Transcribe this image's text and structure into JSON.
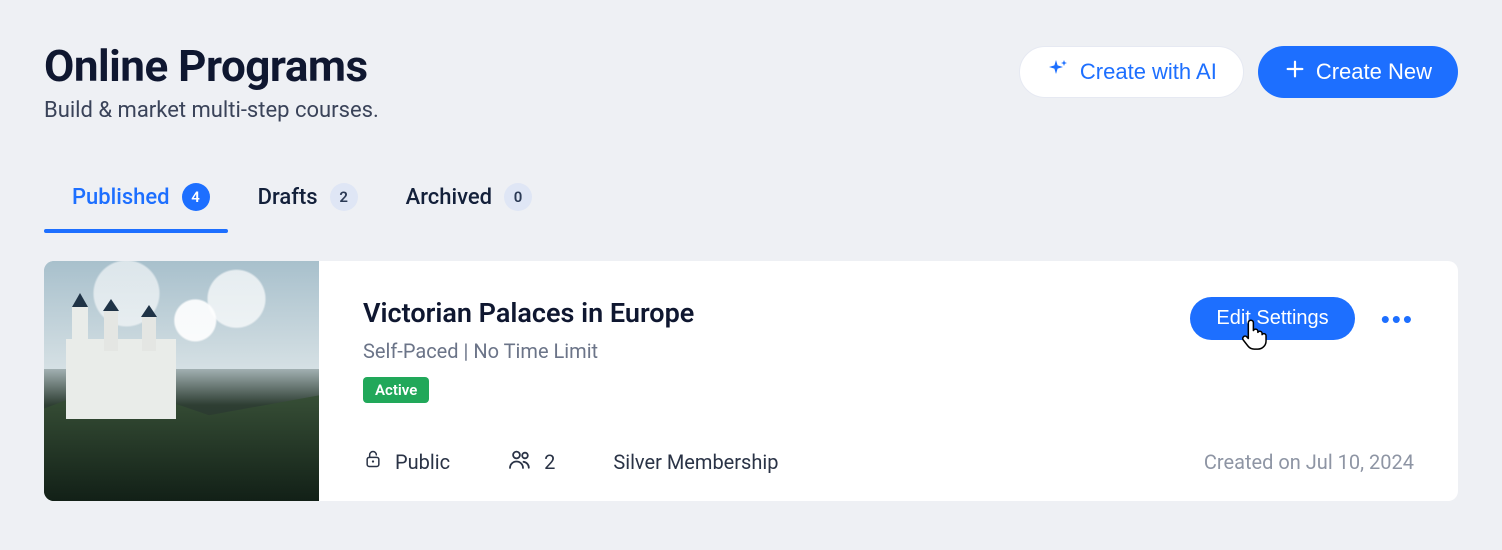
{
  "header": {
    "title": "Online Programs",
    "subtitle": "Build & market multi-step courses.",
    "create_ai_label": "Create with AI",
    "create_new_label": "Create New"
  },
  "tabs": [
    {
      "label": "Published",
      "count": "4",
      "active": true
    },
    {
      "label": "Drafts",
      "count": "2",
      "active": false
    },
    {
      "label": "Archived",
      "count": "0",
      "active": false
    }
  ],
  "card": {
    "title": "Victorian Palaces in Europe",
    "subtitle": "Self-Paced | No Time Limit",
    "status": "Active",
    "visibility": "Public",
    "participants": "2",
    "plan": "Silver Membership",
    "created": "Created on Jul 10, 2024",
    "edit_label": "Edit Settings"
  },
  "colors": {
    "primary": "#1d6fff",
    "success": "#21a85a"
  }
}
